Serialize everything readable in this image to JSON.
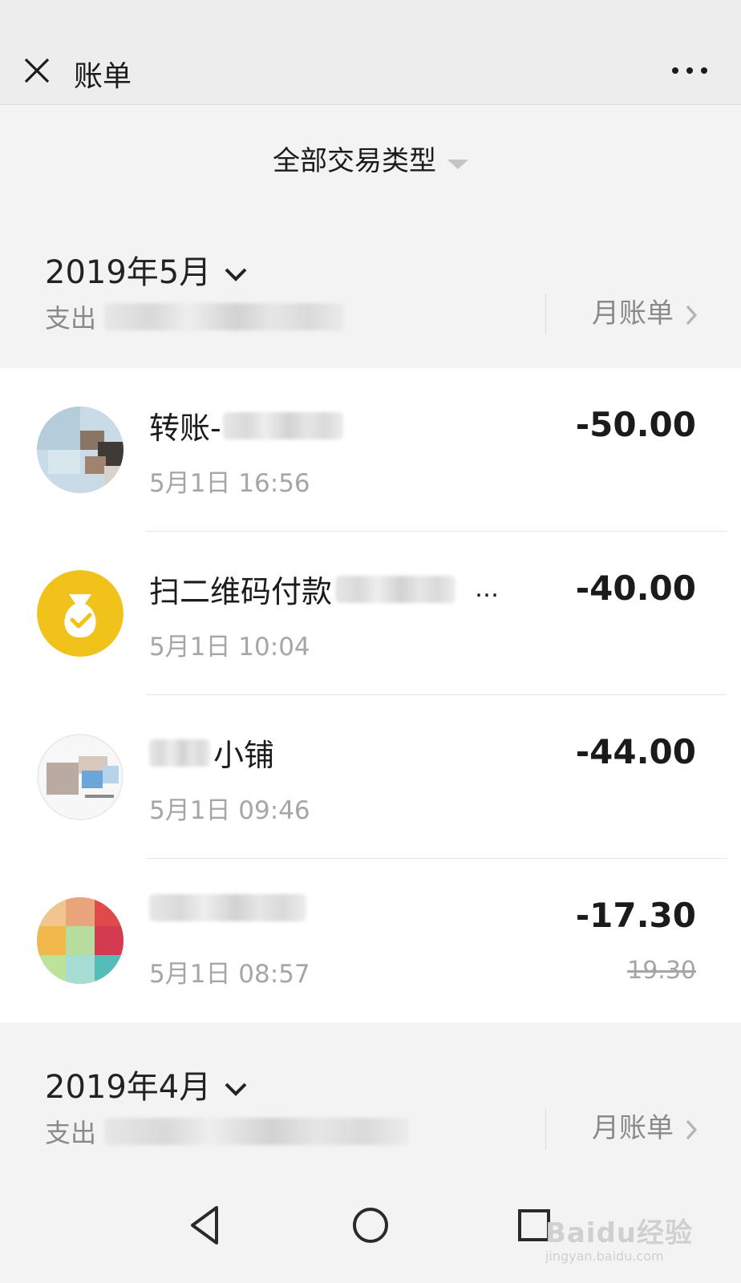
{
  "header": {
    "title": "账单"
  },
  "filter": {
    "label": "全部交易类型"
  },
  "months": [
    {
      "title": "2019年5月",
      "expense_label": "支出",
      "bill_link": "月账单"
    },
    {
      "title": "2019年4月",
      "expense_label": "支出",
      "bill_link": "月账单"
    }
  ],
  "transactions": [
    {
      "name": "转账-",
      "time": "5月1日 16:56",
      "amount": "-50.00",
      "icon": "contact-avatar"
    },
    {
      "name": "扫二维码付款",
      "name_suffix": "…",
      "time": "5月1日 10:04",
      "amount": "-40.00",
      "icon": "money-bag-icon"
    },
    {
      "name": "小铺",
      "time": "5月1日 09:46",
      "amount": "-44.00",
      "icon": "shop-avatar"
    },
    {
      "name": "",
      "time": "5月1日 08:57",
      "amount": "-17.30",
      "original_amount": "19.30",
      "icon": "merchant-avatar"
    }
  ],
  "colors": {
    "money_bag_bg": "#f0c21a",
    "page_bg": "#f3f3f3",
    "card_bg": "#ffffff",
    "secondary_text": "#a6a6a6"
  }
}
